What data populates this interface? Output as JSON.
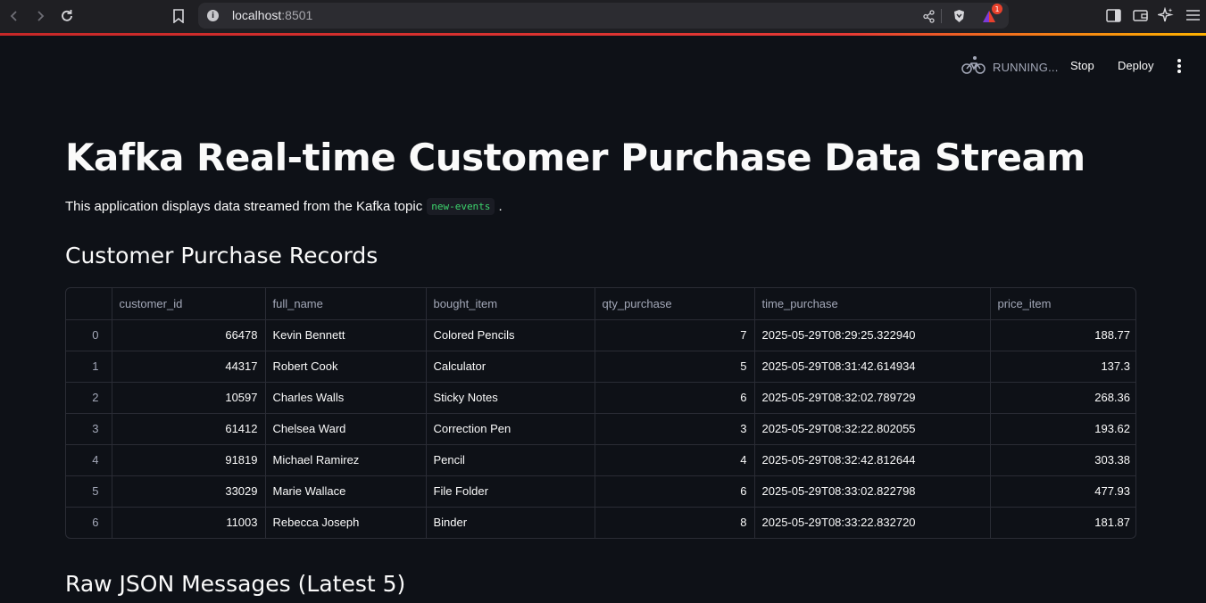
{
  "browser": {
    "url_host": "localhost",
    "url_port": ":8501",
    "notification_count": "1"
  },
  "app_header": {
    "status": "RUNNING...",
    "stop_label": "Stop",
    "deploy_label": "Deploy"
  },
  "page": {
    "title": "Kafka Real-time Customer Purchase Data Stream",
    "intro_text": "This application displays data streamed from the Kafka topic",
    "topic": "new-events",
    "intro_suffix": ".",
    "records_heading": "Customer Purchase Records",
    "raw_heading": "Raw JSON Messages (Latest 5)"
  },
  "table": {
    "columns": [
      "",
      "customer_id",
      "full_name",
      "bought_item",
      "qty_purchase",
      "time_purchase",
      "price_item"
    ],
    "rows": [
      [
        "0",
        "66478",
        "Kevin Bennett",
        "Colored Pencils",
        "7",
        "2025-05-29T08:29:25.322940",
        "188.77"
      ],
      [
        "1",
        "44317",
        "Robert Cook",
        "Calculator",
        "5",
        "2025-05-29T08:31:42.614934",
        "137.3"
      ],
      [
        "2",
        "10597",
        "Charles Walls",
        "Sticky Notes",
        "6",
        "2025-05-29T08:32:02.789729",
        "268.36"
      ],
      [
        "3",
        "61412",
        "Chelsea Ward",
        "Correction Pen",
        "3",
        "2025-05-29T08:32:22.802055",
        "193.62"
      ],
      [
        "4",
        "91819",
        "Michael Ramirez",
        "Pencil",
        "4",
        "2025-05-29T08:32:42.812644",
        "303.38"
      ],
      [
        "5",
        "33029",
        "Marie Wallace",
        "File Folder",
        "6",
        "2025-05-29T08:33:02.822798",
        "477.93"
      ],
      [
        "6",
        "11003",
        "Rebecca Joseph",
        "Binder",
        "8",
        "2025-05-29T08:33:22.832720",
        "181.87"
      ]
    ]
  }
}
